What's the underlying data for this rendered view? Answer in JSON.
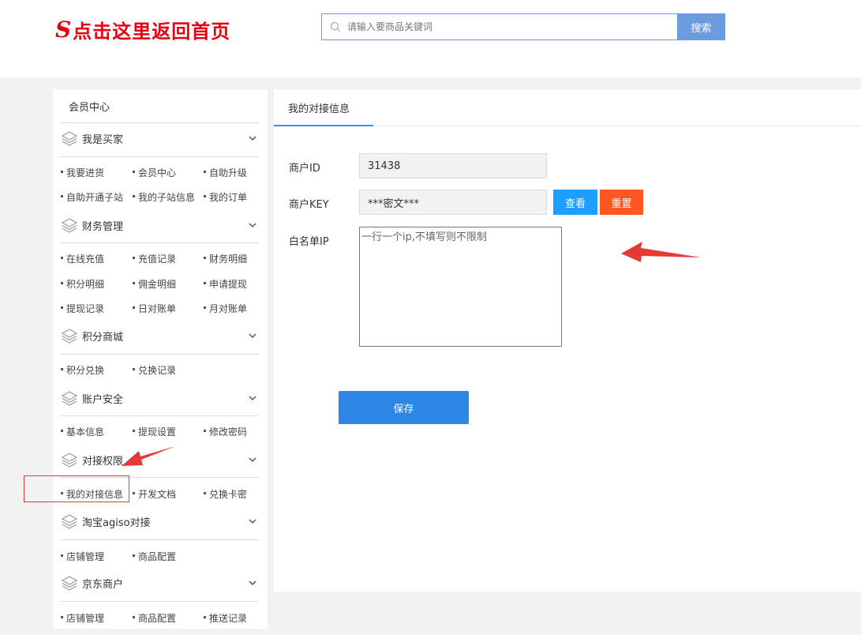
{
  "header": {
    "logo_mark": "S",
    "logo_text": "点击这里返回首页",
    "search_placeholder": "请输入要商品关键词",
    "search_button": "搜索",
    "colors": {
      "logo": "#e60012",
      "search_button": "#6c9bdf",
      "search_border": "#6c9bd9"
    }
  },
  "sidebar": {
    "title": "会员中心",
    "groups": [
      {
        "title": "我是买家",
        "items": [
          "我要进货",
          "会员中心",
          "自助升级",
          "自助开通子站",
          "我的子站信息",
          "我的订单"
        ]
      },
      {
        "title": "财务管理",
        "items": [
          "在线充值",
          "充值记录",
          "财务明细",
          "积分明细",
          "佣金明细",
          "申请提现",
          "提现记录",
          "日对账单",
          "月对账单"
        ]
      },
      {
        "title": "积分商城",
        "items": [
          "积分兑换",
          "兑换记录"
        ]
      },
      {
        "title": "账户安全",
        "items": [
          "基本信息",
          "提现设置",
          "修改密码"
        ]
      },
      {
        "title": "对接权限",
        "items": [
          "我的对接信息",
          "开发文档",
          "兑换卡密"
        ]
      },
      {
        "title": "淘宝agiso对接",
        "items": [
          "店铺管理",
          "商品配置"
        ]
      },
      {
        "title": "京东商户",
        "items": [
          "店铺管理",
          "商品配置",
          "推送记录"
        ]
      }
    ]
  },
  "main": {
    "tab_label": "我的对接信息",
    "merchant_id_label": "商户ID",
    "merchant_id_value": "31438",
    "merchant_key_label": "商户KEY",
    "merchant_key_value": "***密文***",
    "view_button": "查看",
    "reset_button": "重置",
    "whitelist_label": "白名单IP",
    "whitelist_placeholder": "一行一个ip,不填写则不限制",
    "save_button": "保存",
    "colors": {
      "view_button": "#1e9fff",
      "reset_button": "#ff5722",
      "save_button": "#2b87e3",
      "tab_accent": "#3a8ee6",
      "annotation": "#e53935"
    }
  }
}
